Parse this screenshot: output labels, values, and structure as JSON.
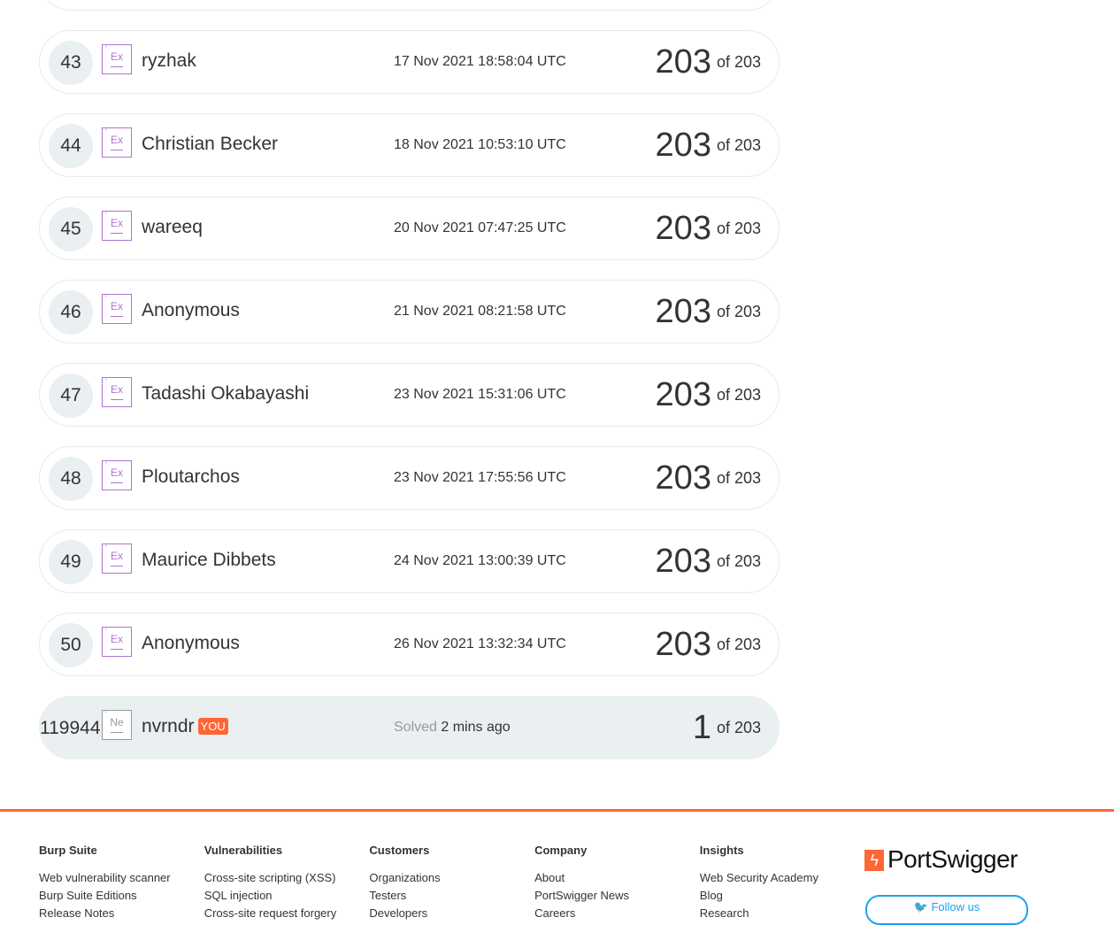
{
  "leaderboard": [
    {
      "rank": "43",
      "badge": "Ex",
      "name": "ryzhak",
      "date": "17 Nov 2021 18:58:04 UTC",
      "score": "203",
      "total": "of 203"
    },
    {
      "rank": "44",
      "badge": "Ex",
      "name": "Christian Becker",
      "date": "18 Nov 2021 10:53:10 UTC",
      "score": "203",
      "total": "of 203"
    },
    {
      "rank": "45",
      "badge": "Ex",
      "name": "wareeq",
      "date": "20 Nov 2021 07:47:25 UTC",
      "score": "203",
      "total": "of 203"
    },
    {
      "rank": "46",
      "badge": "Ex",
      "name": "Anonymous",
      "date": "21 Nov 2021 08:21:58 UTC",
      "score": "203",
      "total": "of 203"
    },
    {
      "rank": "47",
      "badge": "Ex",
      "name": "Tadashi Okabayashi",
      "date": "23 Nov 2021 15:31:06 UTC",
      "score": "203",
      "total": "of 203"
    },
    {
      "rank": "48",
      "badge": "Ex",
      "name": "Ploutarchos",
      "date": "23 Nov 2021 17:55:56 UTC",
      "score": "203",
      "total": "of 203"
    },
    {
      "rank": "49",
      "badge": "Ex",
      "name": "Maurice Dibbets",
      "date": "24 Nov 2021 13:00:39 UTC",
      "score": "203",
      "total": "of 203"
    },
    {
      "rank": "50",
      "badge": "Ex",
      "name": "Anonymous",
      "date": "26 Nov 2021 13:32:34 UTC",
      "score": "203",
      "total": "of 203"
    }
  ],
  "me": {
    "rank": "119944",
    "badge": "Ne",
    "name": "nvrndr",
    "you": "YOU",
    "solved_label": "Solved",
    "solved_time": "2 mins ago",
    "score": "1",
    "total": "of 203"
  },
  "footer": {
    "columns": [
      {
        "title": "Burp Suite",
        "links": [
          "Web vulnerability scanner",
          "Burp Suite Editions",
          "Release Notes"
        ]
      },
      {
        "title": "Vulnerabilities",
        "links": [
          "Cross-site scripting (XSS)",
          "SQL injection",
          "Cross-site request forgery"
        ]
      },
      {
        "title": "Customers",
        "links": [
          "Organizations",
          "Testers",
          "Developers"
        ]
      },
      {
        "title": "Company",
        "links": [
          "About",
          "PortSwigger News",
          "Careers"
        ]
      },
      {
        "title": "Insights",
        "links": [
          "Web Security Academy",
          "Blog",
          "Research"
        ]
      }
    ],
    "logo": "PortSwigger",
    "follow": "Follow us"
  },
  "colors": {
    "accent": "#ff6633",
    "badge": "#b074d0"
  }
}
